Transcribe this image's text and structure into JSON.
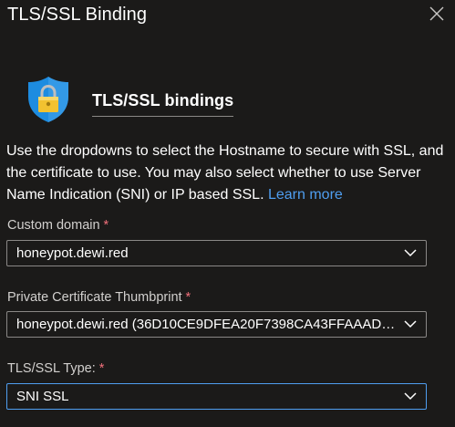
{
  "panel": {
    "title": "TLS/SSL Binding",
    "close_icon": "close-icon"
  },
  "section": {
    "icon": "shield-lock-icon",
    "heading": "TLS/SSL bindings"
  },
  "description": {
    "text": "Use the dropdowns to select the Hostname to secure with SSL, and the certificate to use. You may also select whether to use Server Name Indication (SNI) or IP based SSL.",
    "link": "Learn more"
  },
  "fields": {
    "custom_domain": {
      "label": "Custom domain",
      "required_mark": "*",
      "value": "honeypot.dewi.red"
    },
    "thumbprint": {
      "label": "Private Certificate Thumbprint",
      "required_mark": "*",
      "value": "honeypot.dewi.red (36D10CE9DFEA20F7398CA43FFAAAD8..."
    },
    "ssl_type": {
      "label": "TLS/SSL Type:",
      "required_mark": "*",
      "value": "SNI SSL"
    }
  },
  "colors": {
    "background": "#1b1a19",
    "link": "#4f9ef0",
    "required": "#f1707b",
    "focus_border": "#4f9ef0",
    "shield_blue": "#1d8ce0",
    "lock_gold": "#f2c230"
  }
}
